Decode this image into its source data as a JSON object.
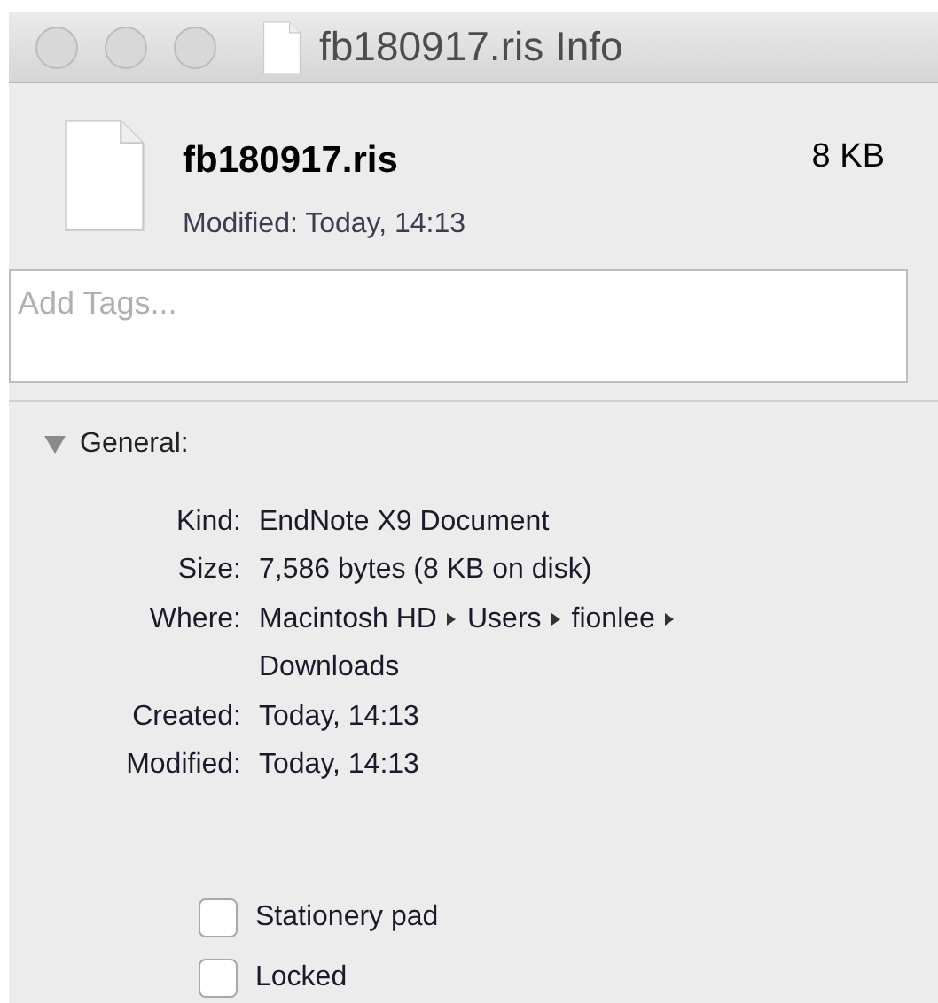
{
  "window": {
    "title": "fb180917.ris Info"
  },
  "header": {
    "name": "fb180917.ris",
    "size": "8 KB",
    "modified": "Modified: Today, 14:13"
  },
  "tags": {
    "placeholder": "Add Tags..."
  },
  "general": {
    "title": "General:",
    "expanded": true,
    "rows": [
      {
        "label": "Kind:",
        "value": "EndNote X9 Document"
      },
      {
        "label": "Size:",
        "value": "7,586 bytes (8 KB on disk)"
      },
      {
        "label": "Where:",
        "path": [
          "Macintosh HD",
          "Users",
          "fionlee",
          "Downloads"
        ]
      },
      {
        "label": "Created:",
        "value": "Today, 14:13"
      },
      {
        "label": "Modified:",
        "value": "Today, 14:13"
      }
    ],
    "options": [
      {
        "label": "Stationery pad",
        "checked": false
      },
      {
        "label": "Locked",
        "checked": false
      }
    ]
  }
}
